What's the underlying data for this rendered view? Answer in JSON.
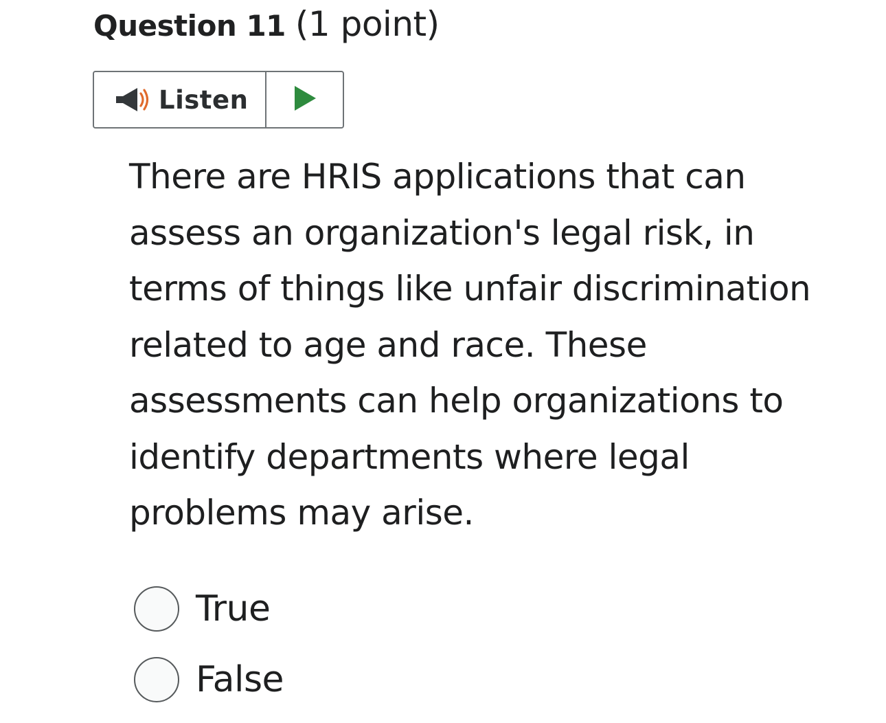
{
  "question": {
    "number_label": "Question 11",
    "points_label": "(1 point)",
    "text": "There are HRIS applications that can assess an organization's legal risk, in terms of things like unfair discrimination related to age and race. These assessments can help organizations to identify departments where legal problems may arise."
  },
  "listen": {
    "label": "Listen",
    "speaker_icon": "speaker-icon",
    "play_icon": "play-icon",
    "accent_color": "#e06a2c",
    "play_color": "#2e8b3e"
  },
  "choices": [
    {
      "label": "True",
      "selected": false
    },
    {
      "label": "False",
      "selected": false
    }
  ]
}
